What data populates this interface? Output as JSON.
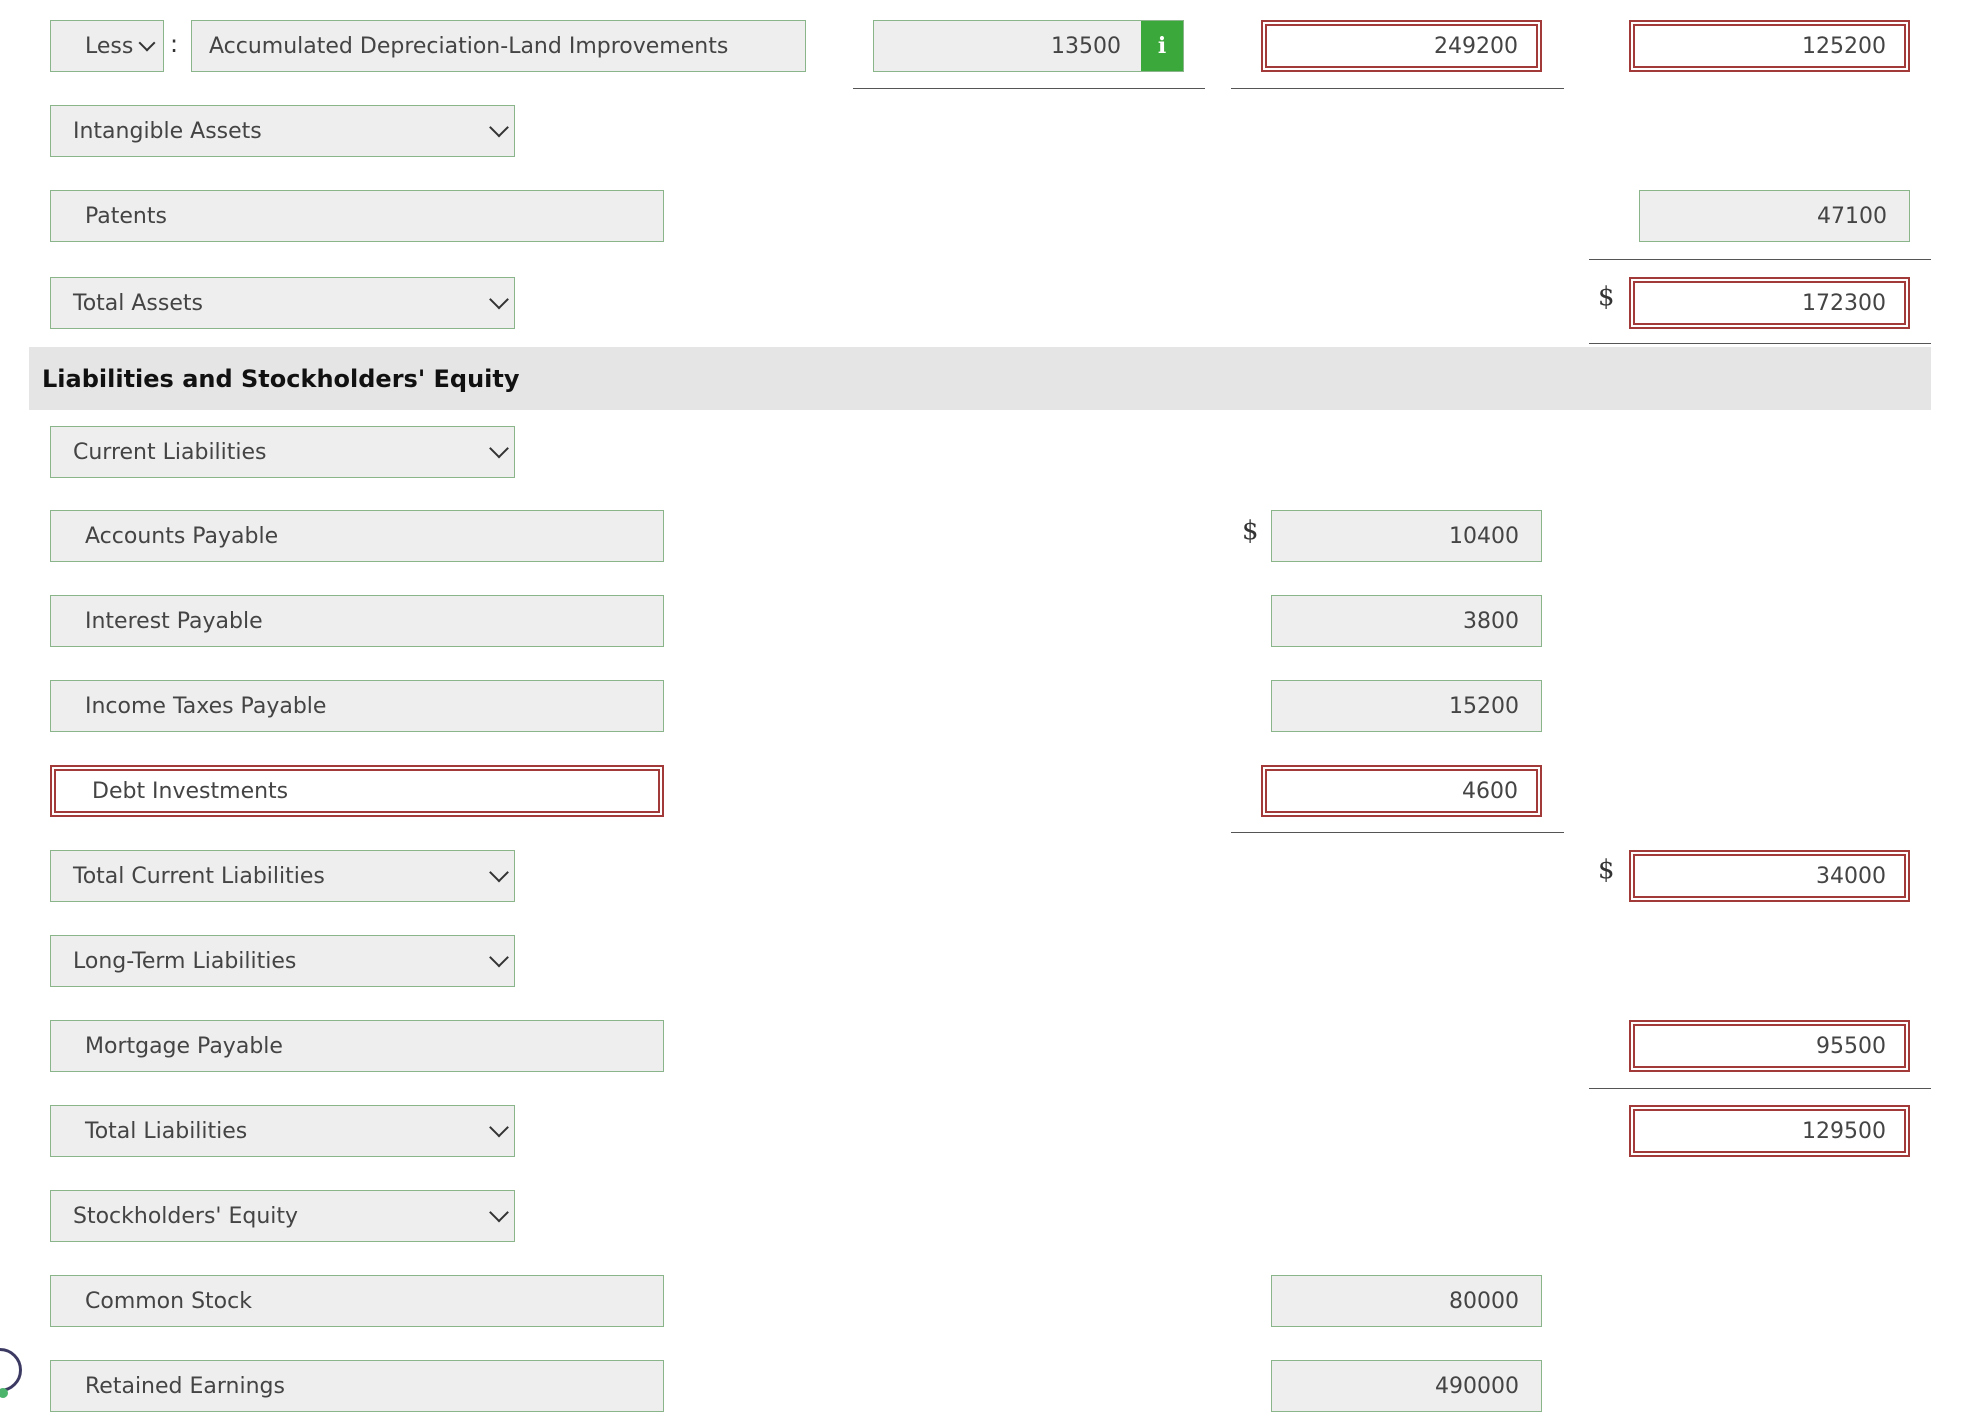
{
  "top_row": {
    "less_label": "Less",
    "colon": ":",
    "accum_label": "Accumulated Depreciation-Land Improvements",
    "value": "13500",
    "info_glyph": "i",
    "subtotal": "249200",
    "total": "125200"
  },
  "intangible_assets": {
    "label": "Intangible Assets"
  },
  "patents": {
    "label": "Patents",
    "value": "47100"
  },
  "total_assets": {
    "label": "Total Assets",
    "currency": "$",
    "value": "172300"
  },
  "section_header": "Liabilities and Stockholders' Equity",
  "current_liabilities": {
    "label": "Current Liabilities"
  },
  "accounts_payable": {
    "label": "Accounts Payable",
    "currency": "$",
    "value": "10400"
  },
  "interest_payable": {
    "label": "Interest Payable",
    "value": "3800"
  },
  "income_taxes_payable": {
    "label": "Income Taxes Payable",
    "value": "15200"
  },
  "debt_investments": {
    "label": "Debt Investments",
    "value": "4600"
  },
  "total_current_liabilities": {
    "label": "Total Current Liabilities",
    "currency": "$",
    "value": "34000"
  },
  "long_term_liabilities": {
    "label": "Long-Term Liabilities"
  },
  "mortgage_payable": {
    "label": "Mortgage Payable",
    "value": "95500"
  },
  "total_liabilities": {
    "label": "Total Liabilities",
    "value": "129500"
  },
  "stockholders_equity": {
    "label": "Stockholders' Equity"
  },
  "common_stock": {
    "label": "Common Stock",
    "value": "80000"
  },
  "retained_earnings": {
    "label": "Retained Earnings",
    "value": "490000"
  },
  "colors": {
    "field_bg": "#eeeeee",
    "field_border": "#8ab58a",
    "error_border": "#a33a3a",
    "info_green": "#3aa83a",
    "band_bg": "#e5e5e5"
  },
  "icons": [
    "chevron-down-icon",
    "info-icon"
  ]
}
